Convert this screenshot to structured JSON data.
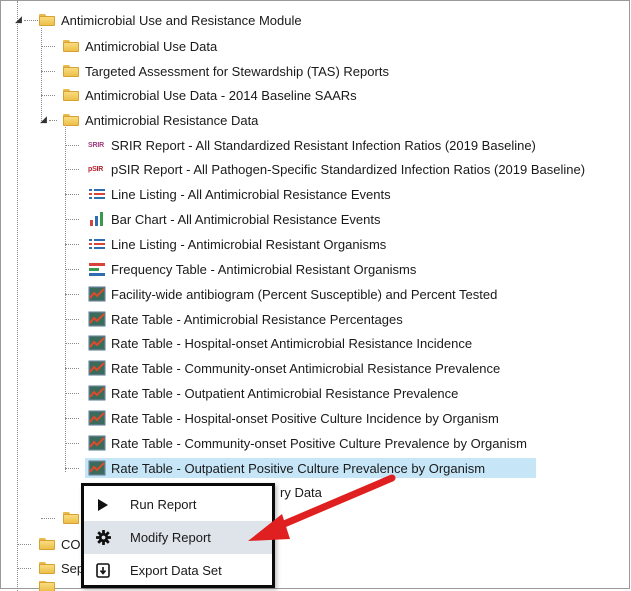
{
  "tree": {
    "module": {
      "label": "Antimicrobial Use and Resistance Module"
    },
    "use_folders": [
      {
        "label": "Antimicrobial Use Data"
      },
      {
        "label": "Targeted Assessment for Stewardship (TAS) Reports"
      },
      {
        "label": "Antimicrobial Use Data - 2014 Baseline SAARs"
      }
    ],
    "resistance_folder": {
      "label": "Antimicrobial Resistance Data"
    },
    "reports": [
      {
        "icon": "srir-icon",
        "badge": "SRIR",
        "label": "SRIR Report - All Standardized Resistant Infection Ratios (2019 Baseline)"
      },
      {
        "icon": "psir-icon",
        "badge": "pSIR",
        "label": "pSIR Report - All Pathogen-Specific Standardized Infection Ratios (2019 Baseline)"
      },
      {
        "icon": "line-listing-icon",
        "label": "Line Listing - All Antimicrobial Resistance Events"
      },
      {
        "icon": "bar-chart-icon",
        "label": "Bar Chart - All Antimicrobial Resistance Events"
      },
      {
        "icon": "line-listing-icon",
        "label": "Line Listing - Antimicrobial Resistant Organisms"
      },
      {
        "icon": "frequency-table-icon",
        "label": "Frequency Table - Antimicrobial Resistant Organisms"
      },
      {
        "icon": "rate-table-icon",
        "label": "Facility-wide antibiogram (Percent Susceptible) and Percent Tested"
      },
      {
        "icon": "rate-table-icon",
        "label": "Rate Table - Antimicrobial Resistance Percentages"
      },
      {
        "icon": "rate-table-icon",
        "label": "Rate Table - Hospital-onset Antimicrobial Resistance Incidence"
      },
      {
        "icon": "rate-table-icon",
        "label": "Rate Table - Community-onset Antimicrobial Resistance Prevalence"
      },
      {
        "icon": "rate-table-icon",
        "label": "Rate Table - Outpatient Antimicrobial Resistance Prevalence"
      },
      {
        "icon": "rate-table-icon",
        "label": "Rate Table - Hospital-onset Positive Culture Incidence by Organism"
      },
      {
        "icon": "rate-table-icon",
        "label": "Rate Table - Community-onset Positive Culture Prevalence by Organism"
      },
      {
        "icon": "rate-table-icon",
        "label": "Rate Table - Outpatient Positive Culture Prevalence by Organism",
        "selected": true
      }
    ],
    "partial_behind_menu": {
      "label": "ry Data"
    },
    "bottom_folders": [
      {
        "label": ""
      },
      {
        "label": "CO"
      },
      {
        "label": "Sep"
      }
    ]
  },
  "context_menu": {
    "items": [
      {
        "icon": "play-icon",
        "label": "Run Report"
      },
      {
        "icon": "gear-icon",
        "label": "Modify Report"
      },
      {
        "icon": "export-icon",
        "label": "Export Data Set"
      }
    ]
  },
  "colors": {
    "selection": "#c6e6f8",
    "menu_hover": "#dfe3ea",
    "annotation_arrow": "#e02020",
    "folder": "#f3cd5e"
  }
}
